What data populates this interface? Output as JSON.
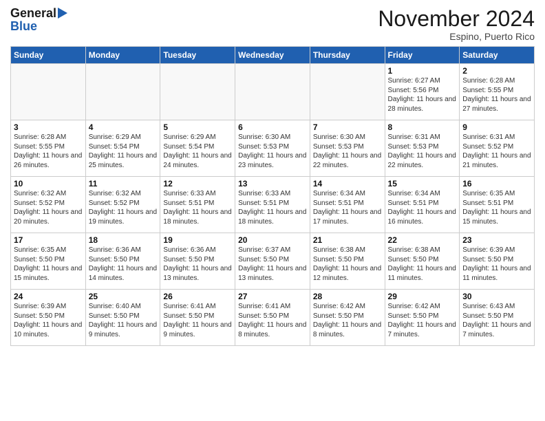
{
  "header": {
    "logo_line1": "General",
    "logo_line2": "Blue",
    "month": "November 2024",
    "location": "Espino, Puerto Rico"
  },
  "weekdays": [
    "Sunday",
    "Monday",
    "Tuesday",
    "Wednesday",
    "Thursday",
    "Friday",
    "Saturday"
  ],
  "weeks": [
    [
      {
        "day": "",
        "info": ""
      },
      {
        "day": "",
        "info": ""
      },
      {
        "day": "",
        "info": ""
      },
      {
        "day": "",
        "info": ""
      },
      {
        "day": "",
        "info": ""
      },
      {
        "day": "1",
        "info": "Sunrise: 6:27 AM\nSunset: 5:56 PM\nDaylight: 11 hours\nand 28 minutes."
      },
      {
        "day": "2",
        "info": "Sunrise: 6:28 AM\nSunset: 5:55 PM\nDaylight: 11 hours\nand 27 minutes."
      }
    ],
    [
      {
        "day": "3",
        "info": "Sunrise: 6:28 AM\nSunset: 5:55 PM\nDaylight: 11 hours\nand 26 minutes."
      },
      {
        "day": "4",
        "info": "Sunrise: 6:29 AM\nSunset: 5:54 PM\nDaylight: 11 hours\nand 25 minutes."
      },
      {
        "day": "5",
        "info": "Sunrise: 6:29 AM\nSunset: 5:54 PM\nDaylight: 11 hours\nand 24 minutes."
      },
      {
        "day": "6",
        "info": "Sunrise: 6:30 AM\nSunset: 5:53 PM\nDaylight: 11 hours\nand 23 minutes."
      },
      {
        "day": "7",
        "info": "Sunrise: 6:30 AM\nSunset: 5:53 PM\nDaylight: 11 hours\nand 22 minutes."
      },
      {
        "day": "8",
        "info": "Sunrise: 6:31 AM\nSunset: 5:53 PM\nDaylight: 11 hours\nand 22 minutes."
      },
      {
        "day": "9",
        "info": "Sunrise: 6:31 AM\nSunset: 5:52 PM\nDaylight: 11 hours\nand 21 minutes."
      }
    ],
    [
      {
        "day": "10",
        "info": "Sunrise: 6:32 AM\nSunset: 5:52 PM\nDaylight: 11 hours\nand 20 minutes."
      },
      {
        "day": "11",
        "info": "Sunrise: 6:32 AM\nSunset: 5:52 PM\nDaylight: 11 hours\nand 19 minutes."
      },
      {
        "day": "12",
        "info": "Sunrise: 6:33 AM\nSunset: 5:51 PM\nDaylight: 11 hours\nand 18 minutes."
      },
      {
        "day": "13",
        "info": "Sunrise: 6:33 AM\nSunset: 5:51 PM\nDaylight: 11 hours\nand 18 minutes."
      },
      {
        "day": "14",
        "info": "Sunrise: 6:34 AM\nSunset: 5:51 PM\nDaylight: 11 hours\nand 17 minutes."
      },
      {
        "day": "15",
        "info": "Sunrise: 6:34 AM\nSunset: 5:51 PM\nDaylight: 11 hours\nand 16 minutes."
      },
      {
        "day": "16",
        "info": "Sunrise: 6:35 AM\nSunset: 5:51 PM\nDaylight: 11 hours\nand 15 minutes."
      }
    ],
    [
      {
        "day": "17",
        "info": "Sunrise: 6:35 AM\nSunset: 5:50 PM\nDaylight: 11 hours\nand 15 minutes."
      },
      {
        "day": "18",
        "info": "Sunrise: 6:36 AM\nSunset: 5:50 PM\nDaylight: 11 hours\nand 14 minutes."
      },
      {
        "day": "19",
        "info": "Sunrise: 6:36 AM\nSunset: 5:50 PM\nDaylight: 11 hours\nand 13 minutes."
      },
      {
        "day": "20",
        "info": "Sunrise: 6:37 AM\nSunset: 5:50 PM\nDaylight: 11 hours\nand 13 minutes."
      },
      {
        "day": "21",
        "info": "Sunrise: 6:38 AM\nSunset: 5:50 PM\nDaylight: 11 hours\nand 12 minutes."
      },
      {
        "day": "22",
        "info": "Sunrise: 6:38 AM\nSunset: 5:50 PM\nDaylight: 11 hours\nand 11 minutes."
      },
      {
        "day": "23",
        "info": "Sunrise: 6:39 AM\nSunset: 5:50 PM\nDaylight: 11 hours\nand 11 minutes."
      }
    ],
    [
      {
        "day": "24",
        "info": "Sunrise: 6:39 AM\nSunset: 5:50 PM\nDaylight: 11 hours\nand 10 minutes."
      },
      {
        "day": "25",
        "info": "Sunrise: 6:40 AM\nSunset: 5:50 PM\nDaylight: 11 hours\nand 9 minutes."
      },
      {
        "day": "26",
        "info": "Sunrise: 6:41 AM\nSunset: 5:50 PM\nDaylight: 11 hours\nand 9 minutes."
      },
      {
        "day": "27",
        "info": "Sunrise: 6:41 AM\nSunset: 5:50 PM\nDaylight: 11 hours\nand 8 minutes."
      },
      {
        "day": "28",
        "info": "Sunrise: 6:42 AM\nSunset: 5:50 PM\nDaylight: 11 hours\nand 8 minutes."
      },
      {
        "day": "29",
        "info": "Sunrise: 6:42 AM\nSunset: 5:50 PM\nDaylight: 11 hours\nand 7 minutes."
      },
      {
        "day": "30",
        "info": "Sunrise: 6:43 AM\nSunset: 5:50 PM\nDaylight: 11 hours\nand 7 minutes."
      }
    ]
  ]
}
